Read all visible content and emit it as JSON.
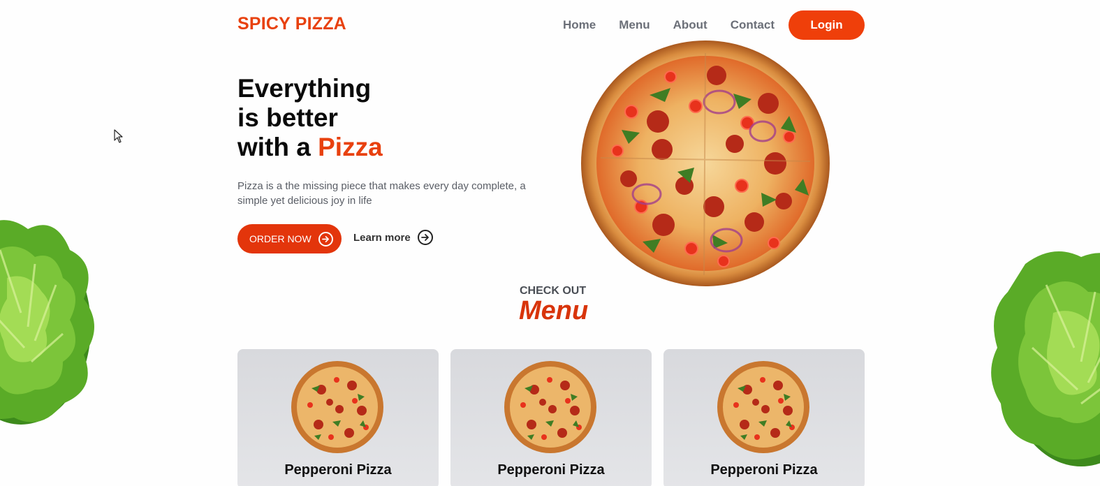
{
  "brand": {
    "name": "SPICY PIZZA",
    "accent_color": "#e8410f"
  },
  "nav": {
    "links": [
      {
        "label": "Home"
      },
      {
        "label": "Menu"
      },
      {
        "label": "About"
      },
      {
        "label": "Contact"
      }
    ],
    "login_label": "Login"
  },
  "hero": {
    "title_line1": "Everything",
    "title_line2": "is better",
    "title_line3_prefix": "with a ",
    "title_line3_accent": "Pizza",
    "description": "Pizza is a the missing piece that makes every day complete, a simple yet delicious joy in life",
    "order_label": "ORDER NOW",
    "learn_more_label": "Learn more"
  },
  "menu_section": {
    "eyebrow": "CHECK OUT",
    "title": "Menu",
    "cards": [
      {
        "name": "Pepperoni Pizza"
      },
      {
        "name": "Pepperoni Pizza"
      },
      {
        "name": "Pepperoni Pizza"
      }
    ]
  },
  "icons": {
    "order": "arrow-right-circle-icon",
    "learn_more": "arrow-right-circle-icon",
    "cursor": "mouse-pointer-icon"
  }
}
